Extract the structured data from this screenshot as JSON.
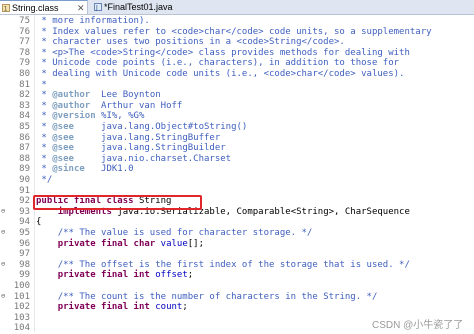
{
  "tabs": [
    {
      "label": "String.class",
      "close": "✕",
      "icon": "class-file-icon",
      "active": true
    },
    {
      "label": "*FinalTest01.java",
      "icon": "java-file-icon",
      "active": false
    }
  ],
  "line_numbers": [
    "75",
    "76",
    "77",
    "78",
    "79",
    "80",
    "81",
    "82",
    "83",
    "84",
    "85",
    "86",
    "87",
    "88",
    "89",
    "90",
    "91",
    "92",
    "93",
    "94",
    "95",
    "96",
    "97",
    "98",
    "99",
    "100",
    "101",
    "102",
    "103",
    "104",
    "105"
  ],
  "code": {
    "l75": "* more information).",
    "l76": "* Index values refer to <code>char</code> code units, so a supplementary",
    "l77": "* character uses two positions in a <code>String</code>.",
    "l78": "* <p>The <code>String</code> class provides methods for dealing with",
    "l79": "* Unicode code points (i.e., characters), in addition to those for",
    "l80": "* dealing with Unicode code units (i.e., <code>char</code> values).",
    "l81": "*",
    "l82_tag": "@author",
    "l82_val": "Lee Boynton",
    "l83_tag": "@author",
    "l83_val": "Arthur van Hoff",
    "l84_tag": "@version",
    "l84_val": "%I%, %G%",
    "l85_tag": "@see",
    "l85_val": "java.lang.Object#toString()",
    "l86_tag": "@see",
    "l86_val": "java.lang.StringBuffer",
    "l87_tag": "@see",
    "l87_val": "java.lang.StringBuilder",
    "l88_tag": "@see",
    "l88_val": "java.nio.charset.Charset",
    "l89_tag": "@since",
    "l89_val": "JDK1.0",
    "l90": "*/",
    "l92_kw": "public final class",
    "l92_name": "String",
    "l93_kw": "implements",
    "l93_rest": "java.io.Serializable, Comparable<String>, CharSequence",
    "l94": "{",
    "l95": "/** The value is used for character storage. */",
    "l96_kw": "private final char",
    "l96_field": "value",
    "l96_rest": "[];",
    "l98": "/** The offset is the first index of the storage that is used. */",
    "l99_kw": "private final int",
    "l99_field": "offset",
    "l99_rest": ";",
    "l101": "/** The count is the number of characters in the String. */",
    "l102_kw": "private final int",
    "l102_field": "count",
    "l102_rest": ";"
  },
  "watermark": "CSDN @小牛瓷了了",
  "colors": {
    "javadoc": "#3f5fbf",
    "keyword": "#7f0055",
    "field": "#0000c0",
    "highlight_border": "#e0262b"
  }
}
